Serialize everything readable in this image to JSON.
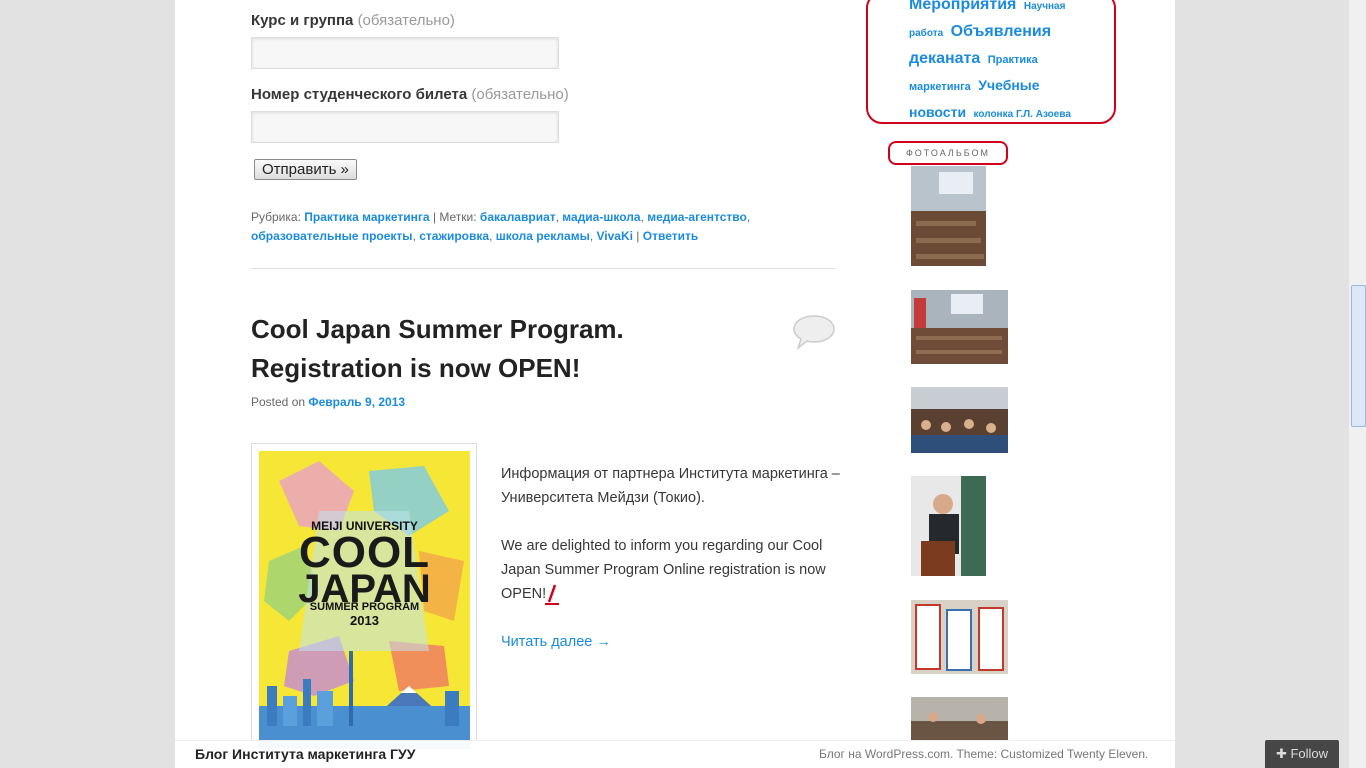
{
  "form": {
    "course_label": "Курс и группа",
    "required": "(обязательно)",
    "student_id_label": "Номер студенческого билета",
    "submit": "Отправить »"
  },
  "meta": {
    "rubric_prefix": "Рубрика:",
    "rubric": "Практика маркетинга",
    "tags_prefix": "| Метки:",
    "tags": [
      "бакалавриат",
      "мадиа-школа",
      "медиа-агентство",
      "образовательные проекты",
      "стажировка",
      "школа рекламы",
      "VivaKi"
    ],
    "reply": "Ответить"
  },
  "post": {
    "title_line1": "Cool Japan Summer Program.",
    "title_line2": "Registration is now OPEN!",
    "posted_on": "Posted on",
    "date": "Февраль 9, 2013",
    "para1": "Информация от партнера Института маркетинга – Университета Мейдзи (Токио).",
    "para2": "We are delighted to inform you regarding our Cool Japan Summer Program Online registration is now OPEN!",
    "read_more": "Читать далее →",
    "poster": {
      "university": "MEIJI UNIVERSITY",
      "cool": "COOL",
      "japan": "JAPAN",
      "program": "SUMMER PROGRAM",
      "year": "2013"
    }
  },
  "sidebar": {
    "tags": [
      {
        "text": "Мероприятия",
        "size": 16
      },
      {
        "text": "Научная работа",
        "size": 10
      },
      {
        "text": "Объявления деканата",
        "size": 16
      },
      {
        "text": "Практика маркетинга",
        "size": 11
      },
      {
        "text": "Учебные новости",
        "size": 14
      },
      {
        "text": "колонка Г.Л. Азоева",
        "size": 10
      }
    ],
    "photo_widget_title": "ФОТОАЛЬБОМ"
  },
  "bottom_bar": {
    "blog_title": "Блог Института маркетинга ГУУ",
    "credit": "Блог на WordPress.com. Theme: Customized Twenty Eleven.",
    "follow": "Follow"
  },
  "colors": {
    "link": "#1b8be0",
    "highlight": "#d0021b"
  }
}
